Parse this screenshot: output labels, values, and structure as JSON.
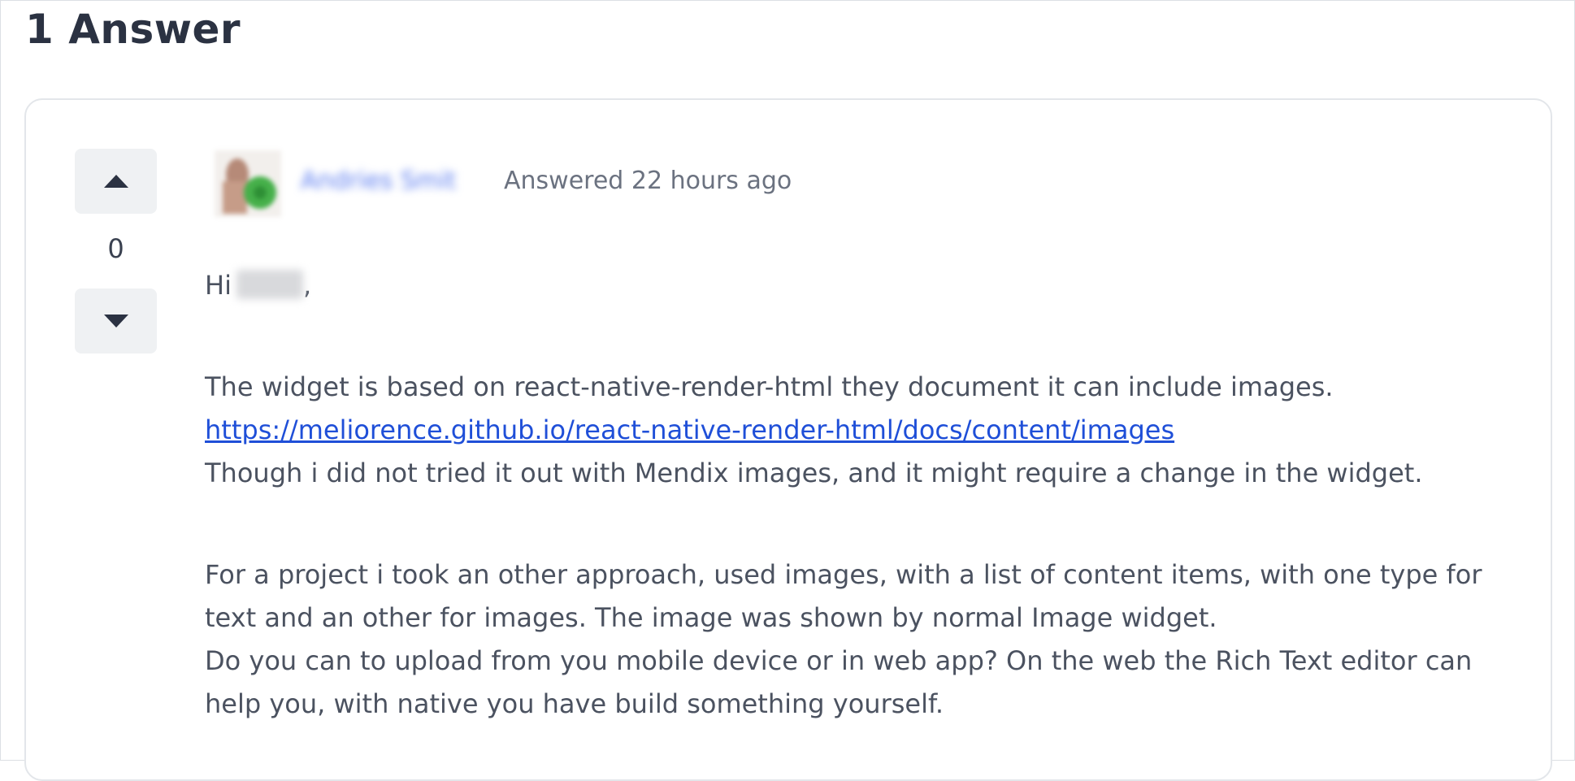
{
  "heading": "1 Answer",
  "answer": {
    "vote_count": "0",
    "author_name": "Andries Smit",
    "answered_label": "Answered 22 hours ago",
    "greeting_prefix": "Hi",
    "greeting_suffix": ",",
    "paragraphs": {
      "p1": "The widget is based on react-native-render-html they document it can include images.",
      "link": "https://meliorence.github.io/react-native-render-html/docs/content/images",
      "p2": "Though i did not tried it out with Mendix images, and it might require a change in the widget.",
      "p3": "For a project i took an other approach, used images, with a list of content items, with one type for text and an other for images. The image was shown by normal Image widget.",
      "p4": "Do you can to upload from you mobile device or in web app? On the web the Rich Text editor can help  you, with native you have build something yourself."
    }
  },
  "icons": {
    "upvote": "caret-up-icon",
    "downvote": "caret-down-icon"
  }
}
